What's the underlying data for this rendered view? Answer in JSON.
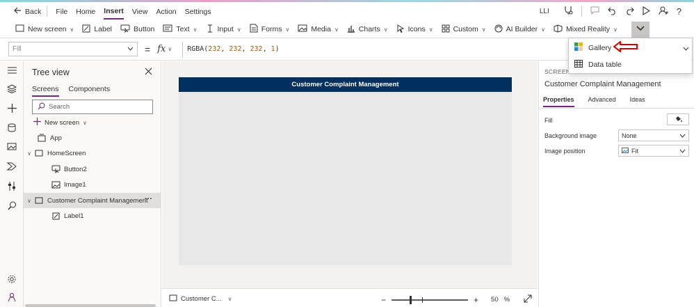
{
  "menubar": {
    "back": "Back",
    "items": [
      "File",
      "Home",
      "Insert",
      "View",
      "Action",
      "Settings"
    ],
    "active": "Insert",
    "user_initials": "LLI"
  },
  "ribbon": {
    "buttons": [
      {
        "label": "New screen",
        "icon": "new-screen-icon",
        "dropdown": true
      },
      {
        "label": "Label",
        "icon": "label-icon",
        "dropdown": false
      },
      {
        "label": "Button",
        "icon": "button-icon",
        "dropdown": false
      },
      {
        "label": "Text",
        "icon": "text-icon",
        "dropdown": true
      },
      {
        "label": "Input",
        "icon": "input-icon",
        "dropdown": true
      },
      {
        "label": "Forms",
        "icon": "forms-icon",
        "dropdown": true
      },
      {
        "label": "Media",
        "icon": "media-icon",
        "dropdown": true
      },
      {
        "label": "Charts",
        "icon": "charts-icon",
        "dropdown": true
      },
      {
        "label": "Icons",
        "icon": "icons-icon",
        "dropdown": true
      },
      {
        "label": "Custom",
        "icon": "custom-icon",
        "dropdown": true
      },
      {
        "label": "AI Builder",
        "icon": "ai-builder-icon",
        "dropdown": true
      },
      {
        "label": "Mixed Reality",
        "icon": "mixed-reality-icon",
        "dropdown": true
      }
    ]
  },
  "popup": {
    "items": [
      {
        "label": "Gallery",
        "icon": "gallery-icon"
      },
      {
        "label": "Data table",
        "icon": "data-table-icon"
      }
    ]
  },
  "formula": {
    "property": "Fill",
    "fx": "fx",
    "func": "RGBA(",
    "args": [
      "232",
      "232",
      "232",
      "1"
    ],
    "close": ")"
  },
  "tree": {
    "title": "Tree view",
    "tabs": [
      "Screens",
      "Components"
    ],
    "active_tab": "Screens",
    "search_placeholder": "Search",
    "new_screen": "New screen",
    "items": [
      {
        "label": "App",
        "depth": 0,
        "icon": "app-icon",
        "caret": false
      },
      {
        "label": "HomeScreen",
        "depth": 0,
        "icon": "screen-icon",
        "caret": true
      },
      {
        "label": "Button2",
        "depth": 1,
        "icon": "button-control-icon",
        "caret": false
      },
      {
        "label": "Image1",
        "depth": 1,
        "icon": "image-control-icon",
        "caret": false
      },
      {
        "label": "Customer Complaint Management",
        "depth": 0,
        "icon": "screen-icon",
        "caret": true,
        "selected": true
      },
      {
        "label": "Label1",
        "depth": 1,
        "icon": "label-control-icon",
        "caret": false
      }
    ],
    "more": "···"
  },
  "canvas": {
    "header_text": "Customer Complaint Management",
    "header_color": "#00305e",
    "background": "#e8e8e8"
  },
  "bottombar": {
    "screen_selector": "Customer C...",
    "zoom": "50",
    "zoom_unit": "%",
    "zoom_level": 0.5
  },
  "props": {
    "kind": "SCREEN",
    "name": "Customer Complaint Management",
    "tabs": [
      "Properties",
      "Advanced",
      "Ideas"
    ],
    "active_tab": "Properties",
    "fill_label": "Fill",
    "bg_image_label": "Background image",
    "bg_image_value": "None",
    "img_pos_label": "Image position",
    "img_pos_value": "Fit"
  },
  "colors": {
    "accent": "#742774",
    "arrow": "#d40000"
  }
}
